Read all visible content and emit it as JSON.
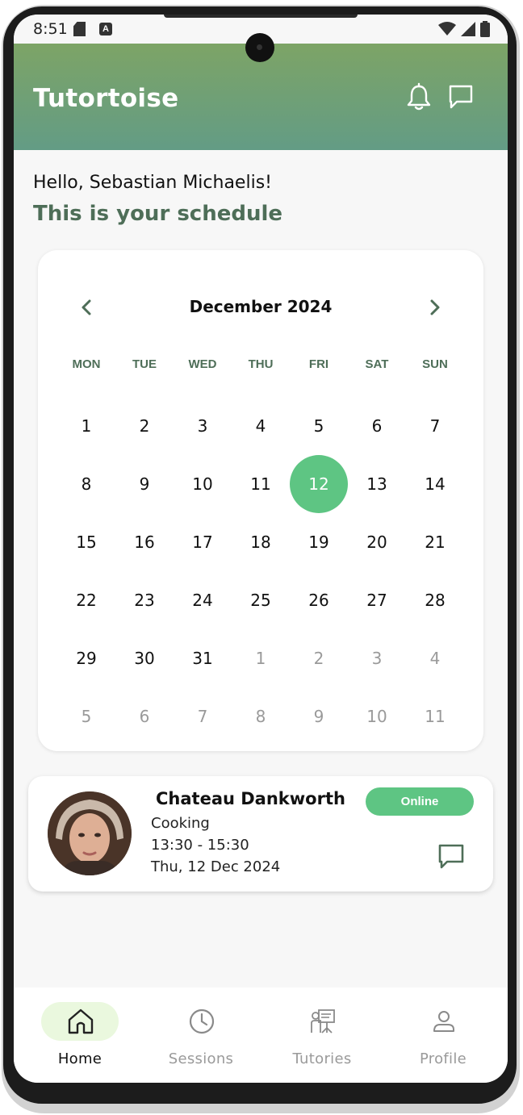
{
  "status_bar": {
    "time": "8:51"
  },
  "header": {
    "title": "Tutortoise"
  },
  "greeting": "Hello, Sebastian Michaelis!",
  "schedule_title": "This is your schedule",
  "calendar": {
    "month_label": "December 2024",
    "weekdays": [
      "MON",
      "TUE",
      "WED",
      "THU",
      "FRI",
      "SAT",
      "SUN"
    ],
    "weeks": [
      [
        "1",
        "2",
        "3",
        "4",
        "5",
        "6",
        "7"
      ],
      [
        "8",
        "9",
        "10",
        "11",
        "12",
        "13",
        "14"
      ],
      [
        "15",
        "16",
        "17",
        "18",
        "19",
        "20",
        "21"
      ],
      [
        "22",
        "23",
        "24",
        "25",
        "26",
        "27",
        "28"
      ],
      [
        "29",
        "30",
        "31",
        "1",
        "2",
        "3",
        "4"
      ],
      [
        "5",
        "6",
        "7",
        "8",
        "9",
        "10",
        "11"
      ]
    ],
    "selected_day": "12"
  },
  "session": {
    "tutor_name": "Chateau Dankworth",
    "subject": "Cooking",
    "time": "13:30 - 15:30",
    "date": "Thu, 12 Dec 2024",
    "status": "Online"
  },
  "nav": {
    "items": [
      {
        "label": "Home",
        "icon": "home-icon"
      },
      {
        "label": "Sessions",
        "icon": "clock-icon"
      },
      {
        "label": "Tutories",
        "icon": "presentation-icon"
      },
      {
        "label": "Profile",
        "icon": "user-icon"
      }
    ],
    "active": "Home"
  },
  "colors": {
    "header_top": "#7da466",
    "header_bottom": "#639c85",
    "accent": "#5ec583",
    "heading": "#4e6e58",
    "nav_active_bg": "#eaf8de"
  }
}
